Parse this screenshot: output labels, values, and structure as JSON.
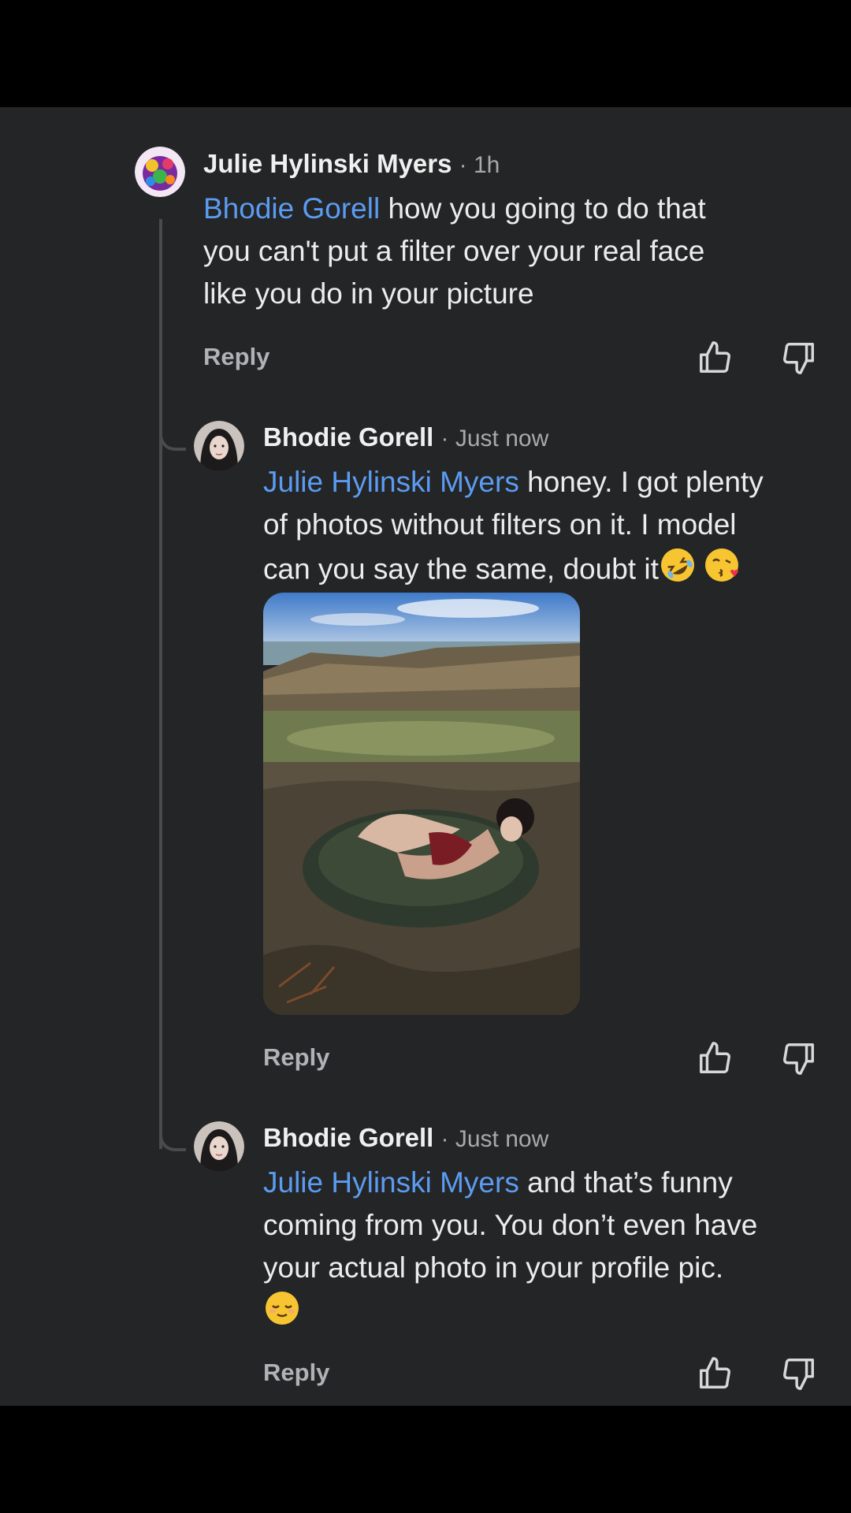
{
  "comments": [
    {
      "author": "Julie Hylinski Myers",
      "time": "· 1h",
      "mention": "Bhodie Gorell",
      "text_lines": [
        " how you going to do that",
        "you can't put a filter over your real face",
        "like you do in your picture"
      ],
      "reply_label": "Reply"
    },
    {
      "author": "Bhodie Gorell",
      "time": "· Just now",
      "mention": "Julie Hylinski Myers",
      "text_lines": [
        " honey. I got plenty",
        "of photos without filters on it. I model",
        "can you say the same, doubt it"
      ],
      "emojis": [
        "rolling-on-floor-laughing-emoji",
        "face-blowing-kiss-emoji"
      ],
      "reply_label": "Reply",
      "attachment": "photo-attachment"
    },
    {
      "author": "Bhodie Gorell",
      "time": "· Just now",
      "mention": "Julie Hylinski Myers",
      "text_lines": [
        " and that’s funny",
        "coming from you. You don’t even have",
        "your actual photo in your profile pic."
      ],
      "emojis": [
        "relieved-face-emoji"
      ],
      "reply_label": "Reply"
    }
  ],
  "icons": {
    "like": "thumbs-up-icon",
    "dislike": "thumbs-down-icon"
  },
  "colors": {
    "background": "#242526",
    "mention": "#5b9cf2",
    "muted": "#a8a9ab"
  }
}
